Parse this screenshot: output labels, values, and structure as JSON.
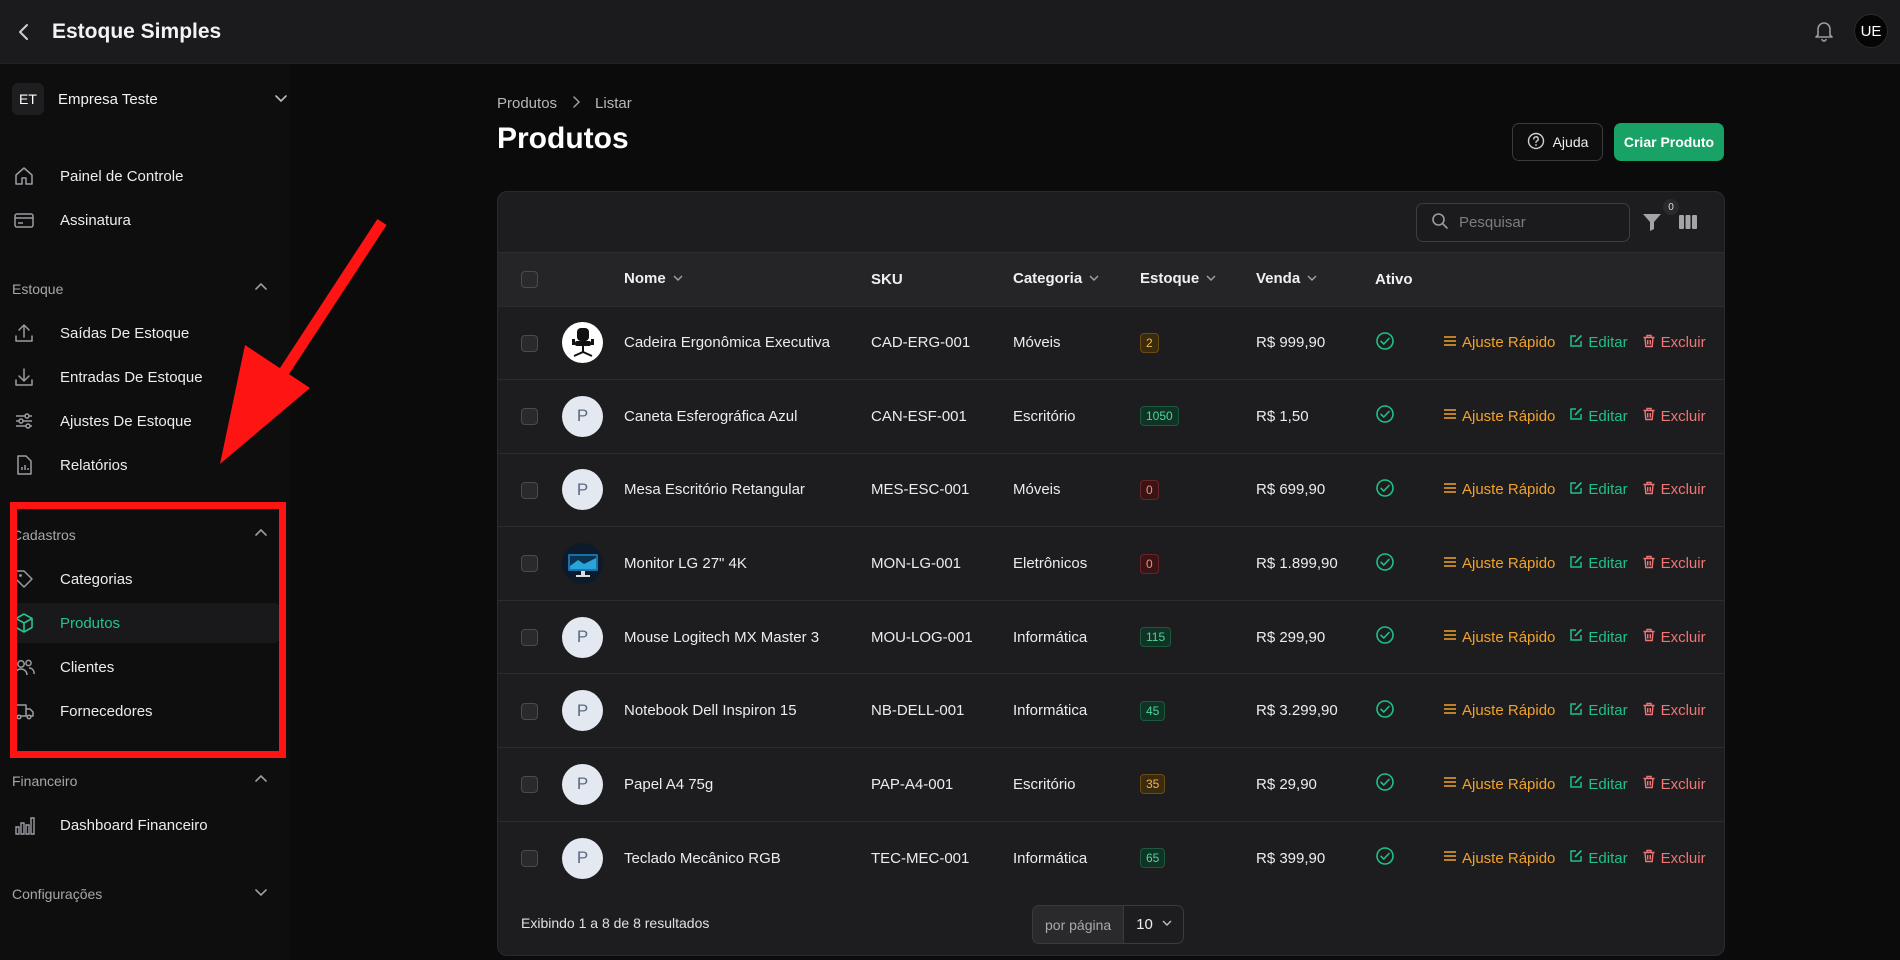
{
  "app": {
    "title": "Estoque Simples",
    "user_initials": "UE"
  },
  "company": {
    "initials": "ET",
    "name": "Empresa Teste"
  },
  "sidebar": {
    "top_items": [
      {
        "label": "Painel de Controle",
        "icon": "home-icon"
      },
      {
        "label": "Assinatura",
        "icon": "credit-card-icon"
      }
    ],
    "sections": [
      {
        "title": "Estoque",
        "items": [
          "Saídas De Estoque",
          "Entradas De Estoque",
          "Ajustes De Estoque",
          "Relatórios"
        ]
      },
      {
        "title": "Cadastros",
        "items": [
          "Categorias",
          "Produtos",
          "Clientes",
          "Fornecedores"
        ],
        "active": "Produtos"
      },
      {
        "title": "Financeiro",
        "items": [
          "Dashboard Financeiro"
        ]
      },
      {
        "title": "Configurações",
        "items": []
      }
    ]
  },
  "breadcrumb": {
    "parent": "Produtos",
    "current": "Listar"
  },
  "page": {
    "title": "Produtos",
    "help_label": "Ajuda",
    "create_label": "Criar Produto"
  },
  "search": {
    "placeholder": "Pesquisar"
  },
  "filter": {
    "count": "0"
  },
  "table": {
    "headers": {
      "name": "Nome",
      "sku": "SKU",
      "category": "Categoria",
      "stock": "Estoque",
      "price": "Venda",
      "active": "Ativo"
    },
    "action_labels": {
      "quick": "Ajuste Rápido",
      "edit": "Editar",
      "delete": "Excluir"
    },
    "rows": [
      {
        "thumb": "chair",
        "name": "Cadeira Ergonômica Executiva",
        "sku": "CAD-ERG-001",
        "category": "Móveis",
        "stock": "2",
        "stock_status": "warn",
        "price": "R$ 999,90"
      },
      {
        "thumb": "P",
        "name": "Caneta Esferográfica Azul",
        "sku": "CAN-ESF-001",
        "category": "Escritório",
        "stock": "1050",
        "stock_status": "ok",
        "price": "R$ 1,50"
      },
      {
        "thumb": "P",
        "name": "Mesa Escritório Retangular",
        "sku": "MES-ESC-001",
        "category": "Móveis",
        "stock": "0",
        "stock_status": "zero",
        "price": "R$ 699,90"
      },
      {
        "thumb": "monitor",
        "name": "Monitor LG 27\" 4K",
        "sku": "MON-LG-001",
        "category": "Eletrônicos",
        "stock": "0",
        "stock_status": "zero",
        "price": "R$ 1.899,90"
      },
      {
        "thumb": "P",
        "name": "Mouse Logitech MX Master 3",
        "sku": "MOU-LOG-001",
        "category": "Informática",
        "stock": "115",
        "stock_status": "ok",
        "price": "R$ 299,90"
      },
      {
        "thumb": "P",
        "name": "Notebook Dell Inspiron 15",
        "sku": "NB-DELL-001",
        "category": "Informática",
        "stock": "45",
        "stock_status": "ok",
        "price": "R$ 3.299,90"
      },
      {
        "thumb": "P",
        "name": "Papel A4 75g",
        "sku": "PAP-A4-001",
        "category": "Escritório",
        "stock": "35",
        "stock_status": "warn",
        "price": "R$ 29,90"
      },
      {
        "thumb": "P",
        "name": "Teclado Mecânico RGB",
        "sku": "TEC-MEC-001",
        "category": "Informática",
        "stock": "65",
        "stock_status": "ok",
        "price": "R$ 399,90"
      }
    ]
  },
  "footer": {
    "summary": "Exibindo 1 a 8 de 8 resultados",
    "per_page_label": "por página",
    "per_page_value": "10"
  },
  "colors": {
    "accent": "#22c58a",
    "create_button": "#19a266",
    "annotation": "#ff1414",
    "quick_adjust": "#f0a22c",
    "delete": "#f07575"
  }
}
